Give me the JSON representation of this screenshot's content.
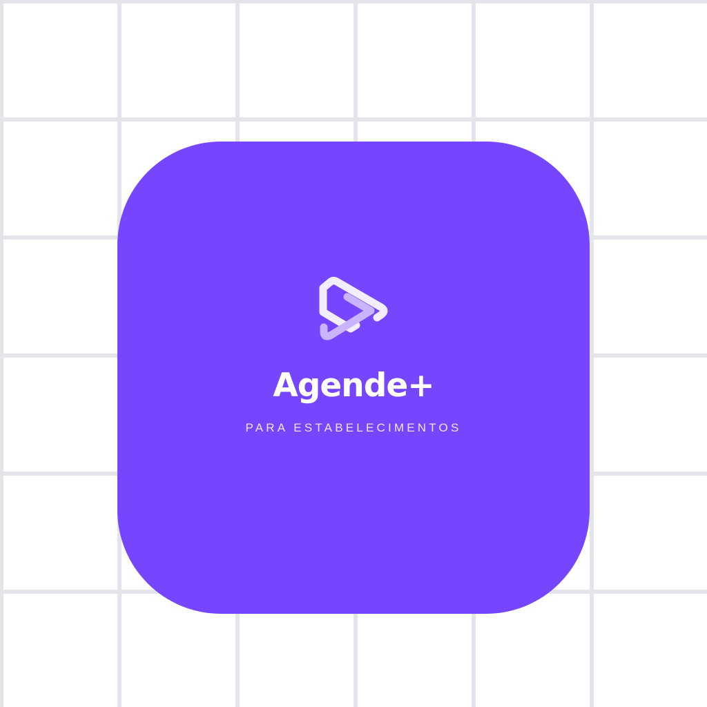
{
  "brand": {
    "name": "Agende+",
    "tagline": "PARA ESTABELECIMENTOS"
  },
  "icons": {
    "logo": "play-s-logo-icon"
  },
  "colors": {
    "background": "#ffffff",
    "grid_line": "#e3e5ea",
    "icon_fill": "#7646fe",
    "text": "#ffffff",
    "logo_primary": "#f2eeff",
    "logo_secondary": "#c9b4ff"
  }
}
